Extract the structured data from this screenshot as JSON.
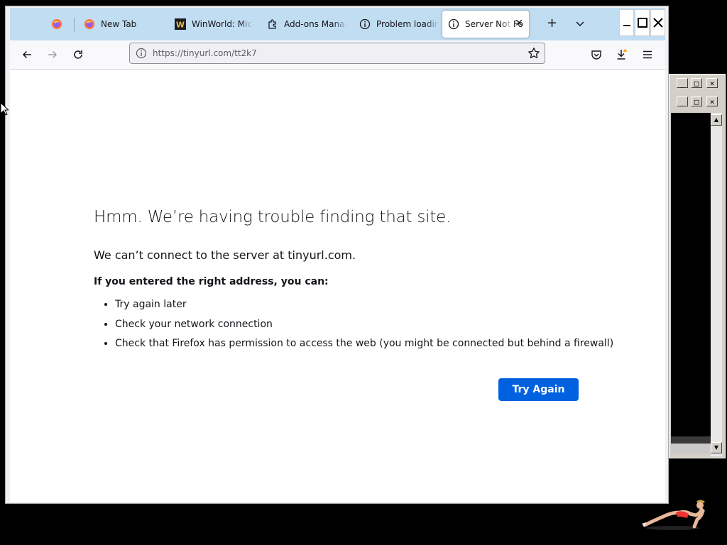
{
  "browser": {
    "tabs": [
      {
        "label": "",
        "icon": "firefox-icon"
      },
      {
        "label": "New Tab",
        "icon": "firefox-icon"
      },
      {
        "label": "WinWorld: Micr",
        "icon": "winworld-icon"
      },
      {
        "label": "Add-ons Manag",
        "icon": "puzzle-icon"
      },
      {
        "label": "Problem loading",
        "icon": "info-icon"
      },
      {
        "label": "Server Not Fo",
        "icon": "info-icon",
        "active": true
      }
    ],
    "new_tab_symbol": "+",
    "window_controls": {
      "minimize": "_",
      "maximize": "☐",
      "close": "✕"
    },
    "url": "https://tinyurl.com/tt2k7"
  },
  "error": {
    "title": "Hmm. We’re having trouble finding that site.",
    "subtitle": "We can’t connect to the server at tinyurl.com.",
    "lead": "If you entered the right address, you can:",
    "suggestions": [
      "Try again later",
      "Check your network connection",
      "Check that Firefox has permission to access the web (you might be connected but behind a firewall)"
    ],
    "button": "Try Again"
  },
  "background_window": {
    "controls": [
      "_",
      "□",
      "×"
    ]
  },
  "colors": {
    "tabstrip": "#c1ddf2",
    "accent_button": "#0061e0",
    "desktop": "#000000"
  }
}
